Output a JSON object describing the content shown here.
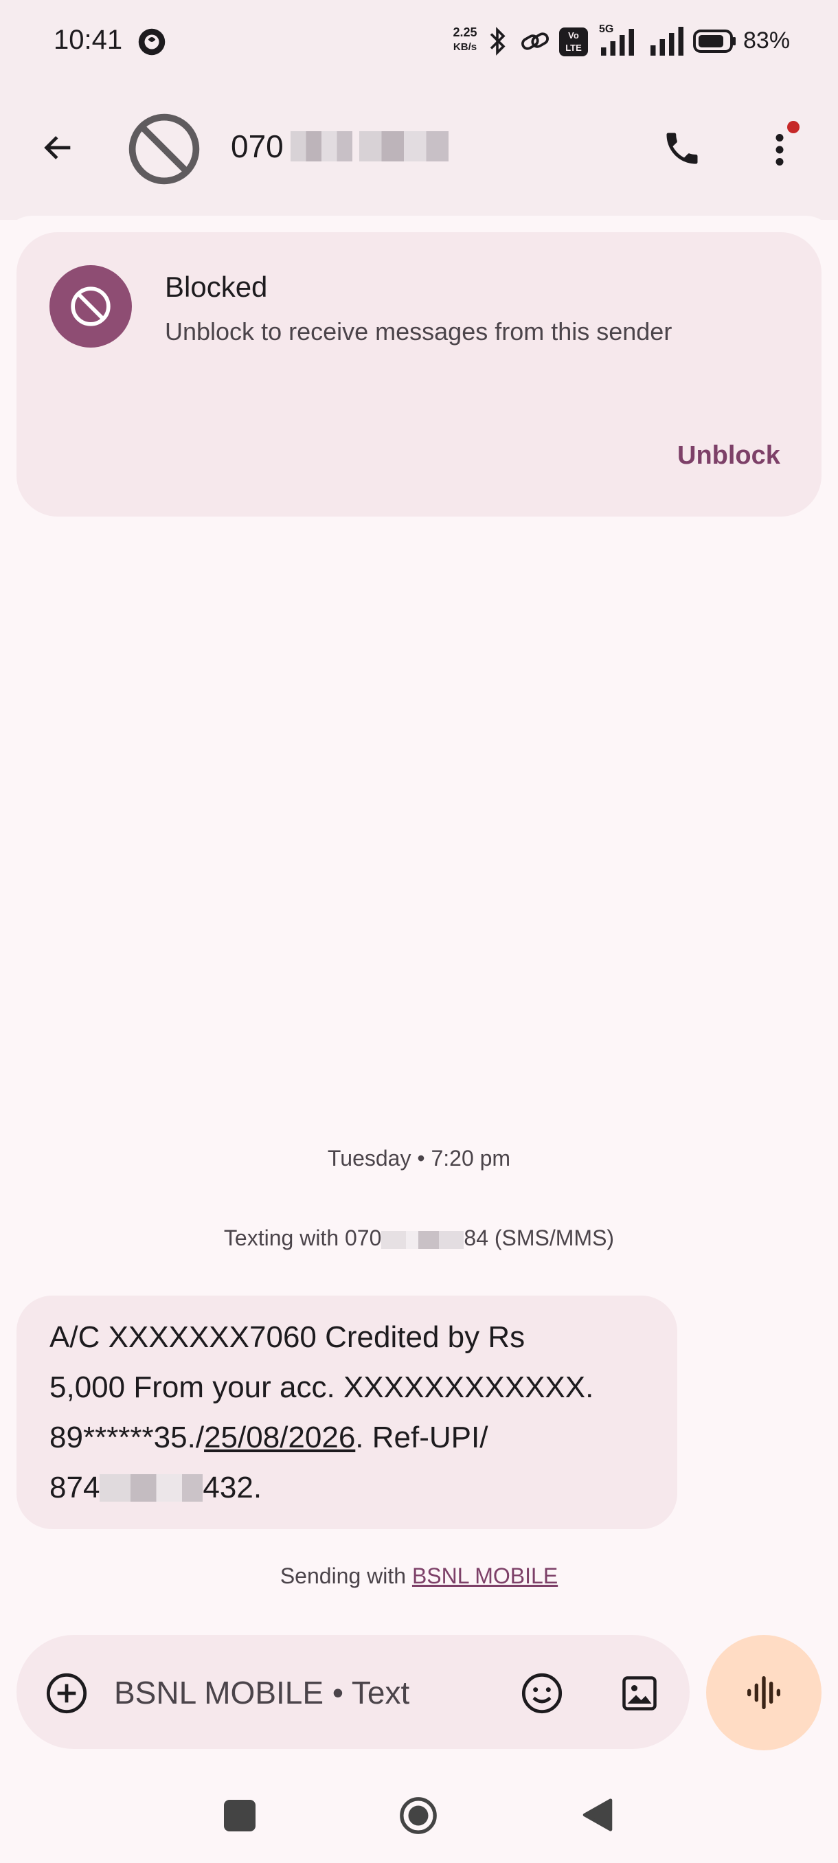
{
  "status_bar": {
    "time": "10:41",
    "net_speed_value": "2.25",
    "net_speed_unit": "KB/s",
    "network": "5G",
    "volte": "Vo LTE",
    "battery_percent": "83%"
  },
  "app_bar": {
    "contact_name": "070",
    "icons": [
      "back-arrow-icon",
      "blocked-avatar-icon",
      "phone-icon",
      "more-vert-icon"
    ]
  },
  "blocked_card": {
    "title": "Blocked",
    "subtitle": "Unblock to receive messages from this sender",
    "action_label": "Unblock",
    "accent": "#8e4d73"
  },
  "conversation": {
    "timestamp": "Tuesday • 7:20 pm",
    "texting_with_prefix": "Texting with 070",
    "texting_with_suffix": "84 (SMS/MMS)",
    "message": {
      "line1": "A/C XXXXXXX7060 Credited by Rs",
      "line2": "5,000 From your acc. XXXXXXXXXXXX.",
      "line3_prefix": "89******35./",
      "line3_date": "25/08/2026",
      "line3_suffix": ". Ref-UPI/",
      "line4_prefix": "874",
      "line4_suffix": "432."
    },
    "sending_with_prefix": "Sending with ",
    "sending_with_sim": "BSNL MOBILE"
  },
  "compose": {
    "placeholder": "BSNL MOBILE • Text",
    "voice_button_color": "#ffdcc4"
  },
  "nav_bar": {
    "icons": [
      "recents-square-icon",
      "home-circle-icon",
      "back-triangle-icon"
    ]
  }
}
